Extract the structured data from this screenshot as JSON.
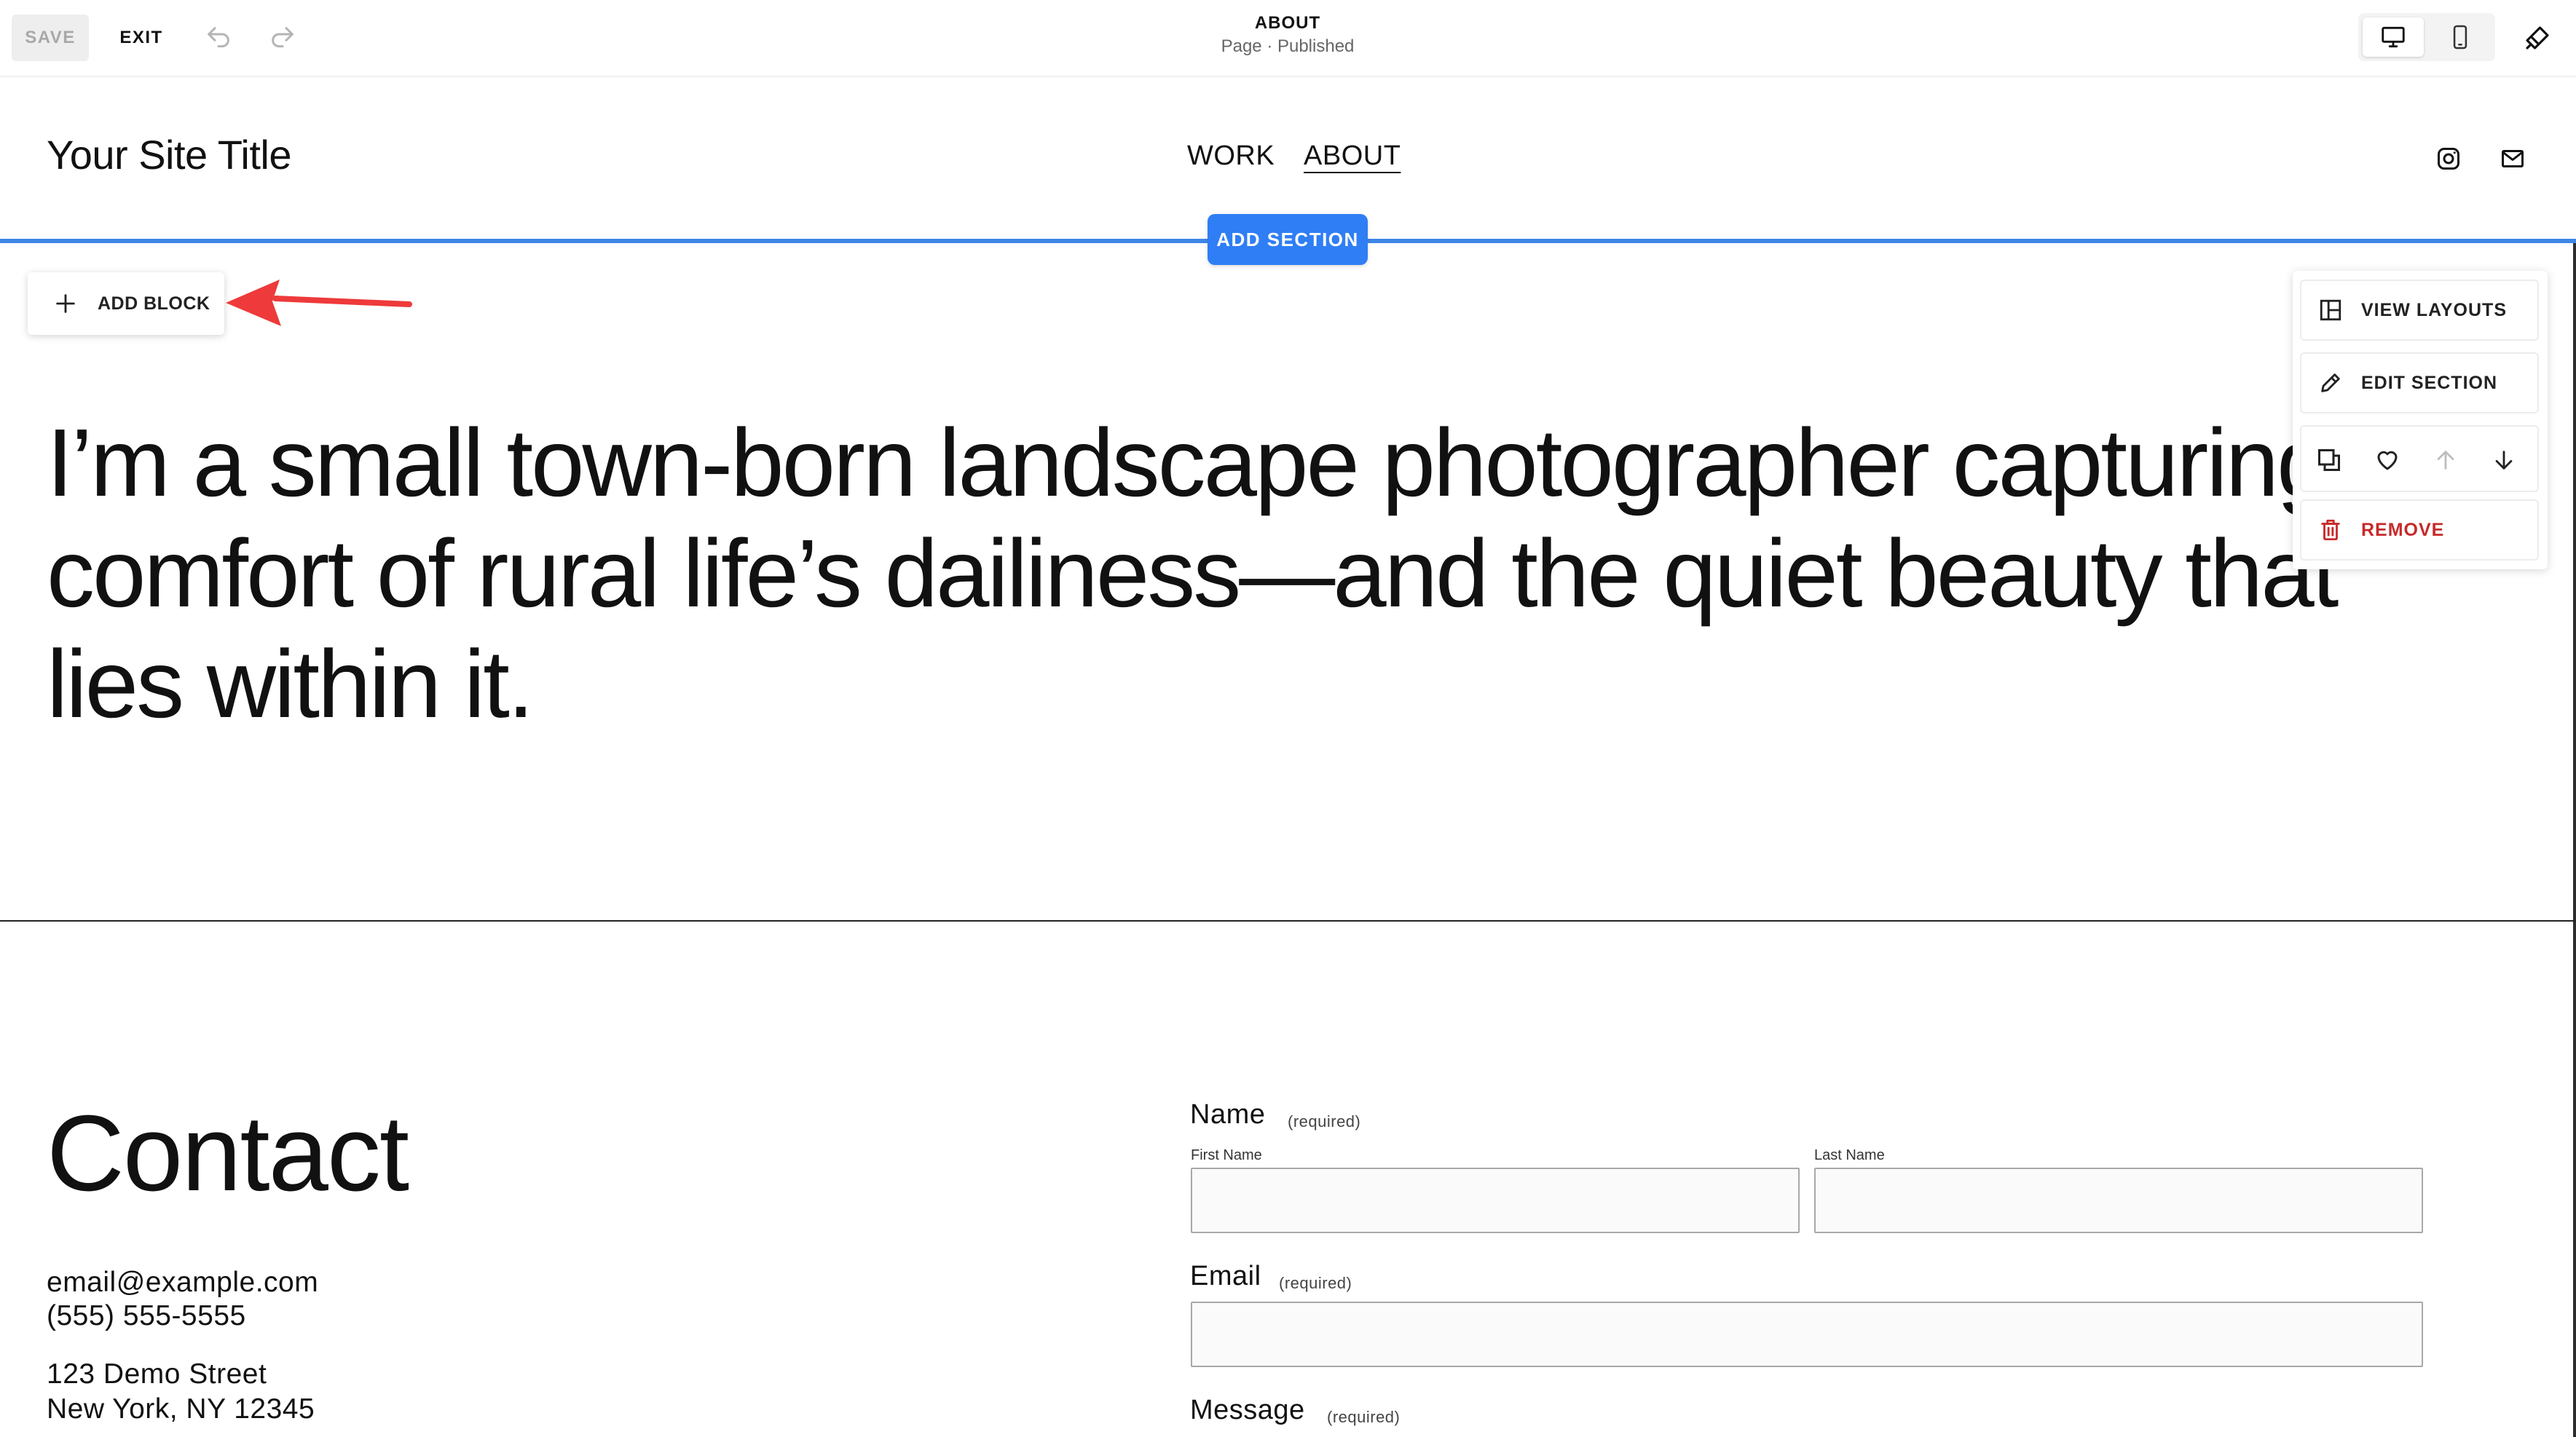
{
  "toolbar": {
    "save_label": "SAVE",
    "exit_label": "EXIT",
    "page_name": "ABOUT",
    "page_status": "Page · Published"
  },
  "site": {
    "title": "Your Site Title",
    "nav": [
      {
        "label": "WORK",
        "active": false
      },
      {
        "label": "ABOUT",
        "active": true
      }
    ]
  },
  "editor": {
    "add_section_label": "ADD SECTION",
    "add_block_label": "ADD BLOCK",
    "section_panel": {
      "view_layouts_label": "VIEW LAYOUTS",
      "edit_section_label": "EDIT SECTION",
      "remove_label": "REMOVE"
    }
  },
  "hero": {
    "text": "I’m a small town-born landscape photographer capturing the comfort of rural life’s dailiness—and the quiet beauty that lies within it."
  },
  "contact": {
    "heading": "Contact",
    "email": "email@example.com",
    "phone": "(555) 555-5555",
    "street": "123 Demo Street",
    "city": "New York, NY 12345"
  },
  "form": {
    "name_label": "Name",
    "required_text": "(required)",
    "first_name_label": "First Name",
    "last_name_label": "Last Name",
    "email_label": "Email",
    "message_label": "Message"
  },
  "colors": {
    "accent_blue": "#2f7ef5",
    "section_line": "#3e86e6",
    "remove_red": "#c62a2a",
    "arrow_red": "#ee3a3a"
  }
}
